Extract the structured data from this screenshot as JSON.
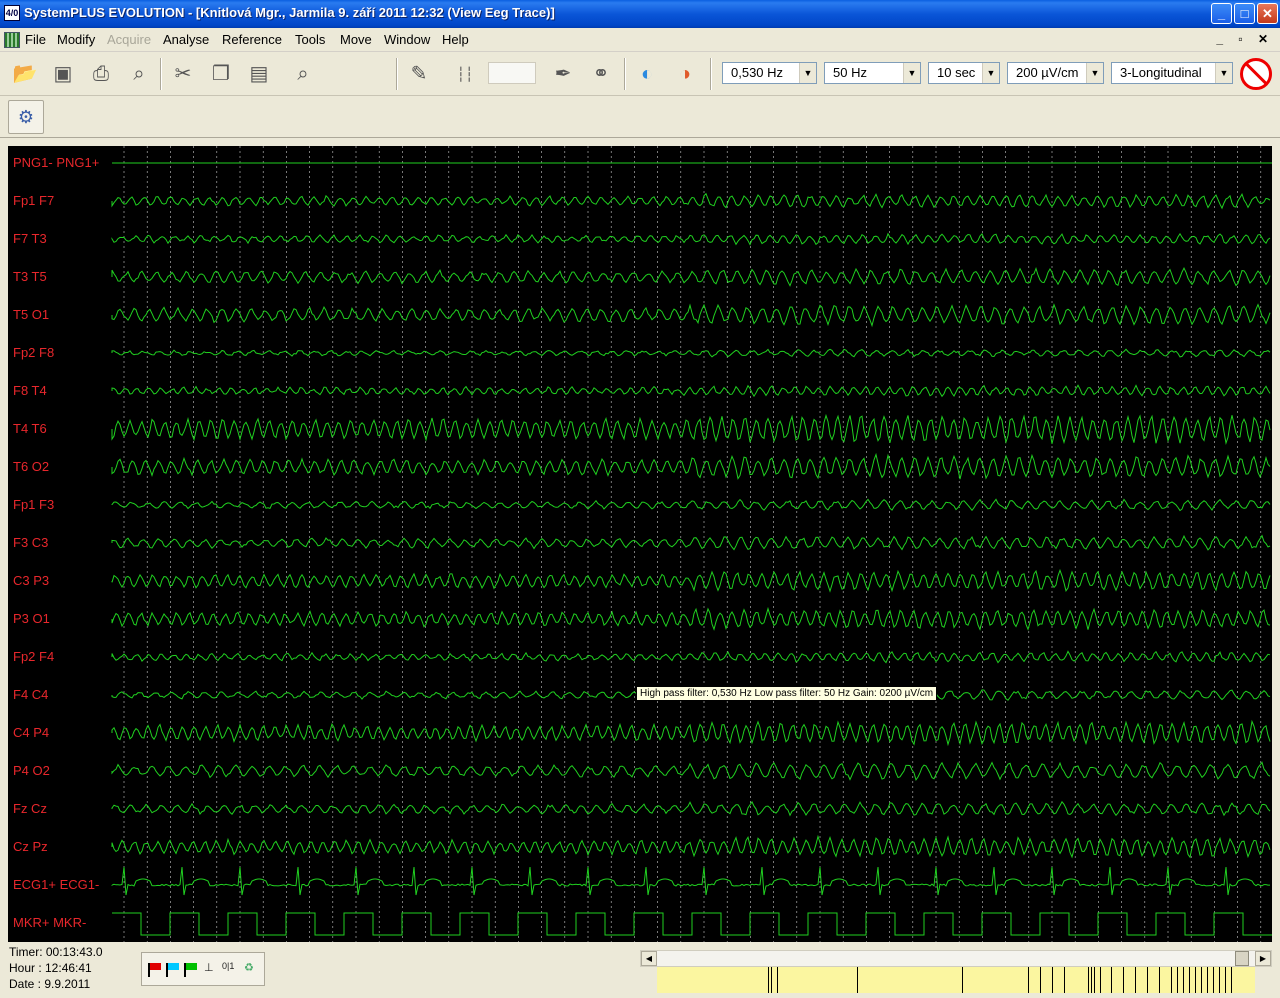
{
  "window": {
    "title": "SystemPLUS EVOLUTION - [Knitlová Mgr., Jarmila 9. září 2011 12:32 (View Eeg Trace)]",
    "icon_label": "4/0",
    "minimize": "_",
    "maximize": "□",
    "close": "✕"
  },
  "menu": {
    "items": [
      "File",
      "Modify",
      "Acquire",
      "Analyse",
      "Reference",
      "Tools",
      "Move",
      "Window",
      "Help"
    ],
    "disabled": [
      "Acquire"
    ],
    "mdi_controls": "_ ▫ ✕"
  },
  "toolbar": {
    "icons": [
      "open-folder-icon",
      "save-icon",
      "print-icon",
      "zoom-icon",
      "cut-icon",
      "copy-icon",
      "paste-icon",
      "find-icon",
      "edit-icon",
      "ruler-icon",
      "pen-icon",
      "link-icon",
      "map-icon",
      "map2-icon"
    ],
    "high_pass": "0,530 Hz",
    "low_pass": "50 Hz",
    "timebase": "10 sec",
    "gain": "200 µV/cm",
    "montage": "3-Longitudinal"
  },
  "channels": [
    "PNG1- PNG1+",
    "Fp1 F7",
    "F7 T3",
    "T3 T5",
    "T5 O1",
    "Fp2 F8",
    "F8 T4",
    "T4 T6",
    "T6 O2",
    "Fp1 F3",
    "F3 C3",
    "C3 P3",
    "P3 O1",
    "Fp2 F4",
    "F4 C4",
    "C4 P4",
    "P4 O2",
    "Fz Cz",
    "Cz Pz",
    "ECG1+ ECG1-",
    "MKR+ MKR-"
  ],
  "tooltip": "High pass filter: 0,530 Hz    Low pass filter: 50 Hz    Gain: 0200 µV/cm",
  "status": {
    "timer": "Timer: 00:13:43.0",
    "hour": "Hour : 12:46:41",
    "date": "Date  : 9.9.2011"
  },
  "flags": {
    "colors": [
      "#e00000",
      "#00c8ff",
      "#00c000"
    ],
    "mini_label": "0|1"
  },
  "timeline": {
    "marker_positions": [
      0.185,
      0.19,
      0.2,
      0.335,
      0.51,
      0.62,
      0.64,
      0.66,
      0.68,
      0.72,
      0.725,
      0.73,
      0.74,
      0.76,
      0.78,
      0.8,
      0.82,
      0.84,
      0.86,
      0.87,
      0.88,
      0.89,
      0.9,
      0.91,
      0.92,
      0.93,
      0.94,
      0.95,
      0.96
    ]
  },
  "colors": {
    "trace": "#20d020",
    "label": "#e8272c",
    "grid": "#c8c8c8",
    "background": "#000000"
  }
}
